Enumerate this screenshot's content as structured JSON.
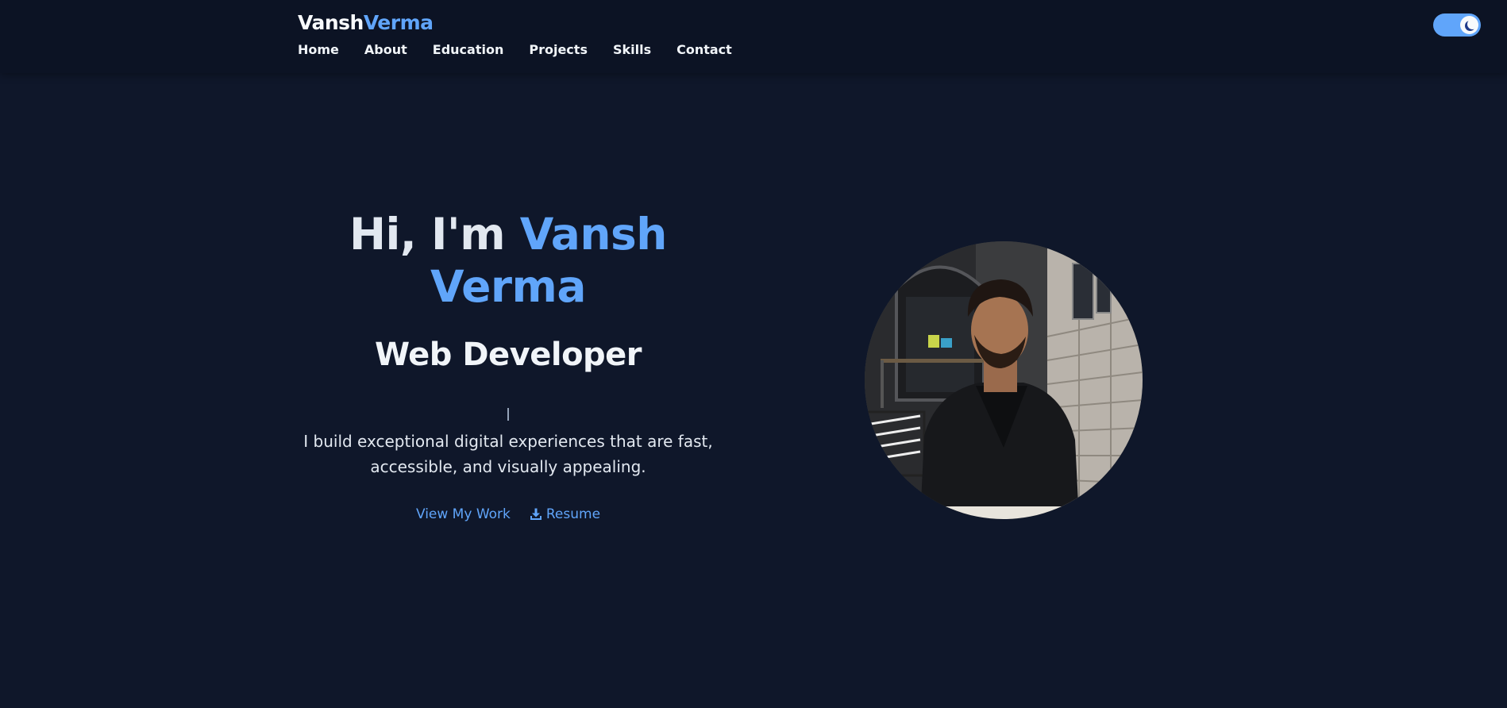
{
  "header": {
    "brand_first": "Vansh",
    "brand_last": "Verma",
    "nav": [
      {
        "label": "Home"
      },
      {
        "label": "About"
      },
      {
        "label": "Education"
      },
      {
        "label": "Projects"
      },
      {
        "label": "Skills"
      },
      {
        "label": "Contact"
      }
    ],
    "theme_toggle": {
      "state": "dark",
      "icon": "moon-icon"
    }
  },
  "hero": {
    "greeting": "Hi, I'm ",
    "name": "Vansh Verma",
    "role": "Web Developer",
    "tagline": "I build exceptional digital experiences that are fast, accessible, and visually appealing.",
    "primary_cta": "View My Work",
    "secondary_cta": "Resume",
    "secondary_cta_icon": "download-icon"
  },
  "colors": {
    "background": "#0f172a",
    "navbar": "#0c1324",
    "accent": "#60a5fa",
    "text": "#e2e8f0"
  }
}
